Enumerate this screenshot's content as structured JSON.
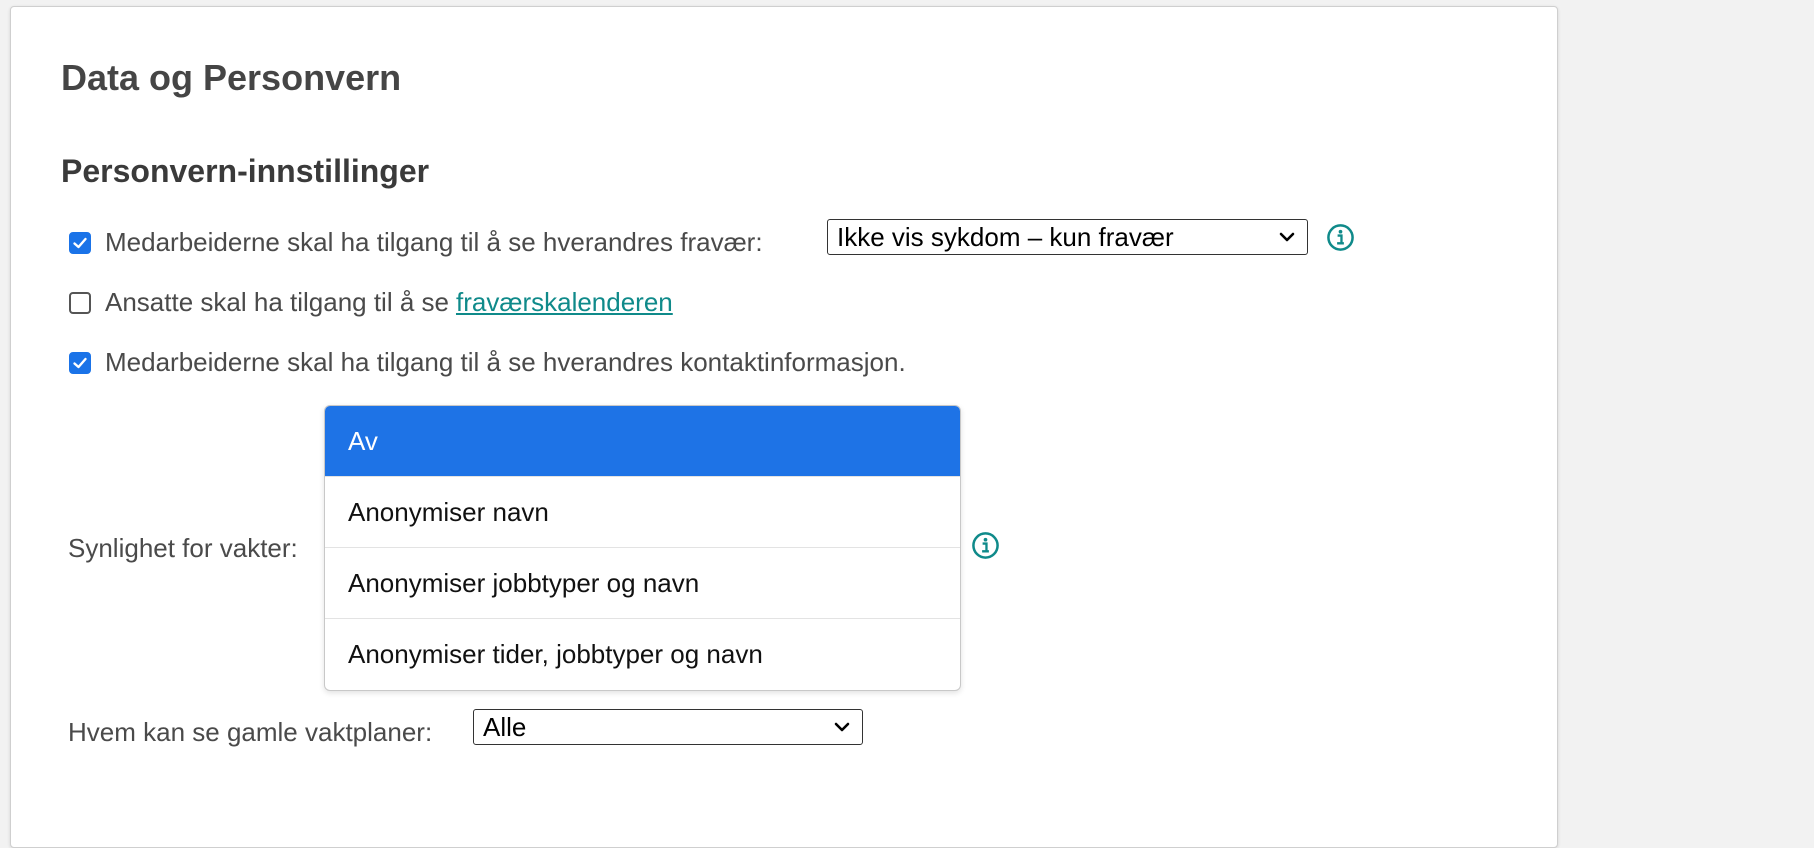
{
  "page": {
    "title": "Data og Personvern",
    "section_title": "Personvern-innstillinger"
  },
  "settings": {
    "absence": {
      "checked": true,
      "label": "Medarbeiderne skal ha tilgang til å se hverandres fravær:",
      "select_value": "Ikke vis sykdom – kun fravær"
    },
    "calendar": {
      "checked": false,
      "label": "Ansatte skal ha tilgang til å se",
      "link_text": "fraværskalenderen"
    },
    "contact": {
      "checked": true,
      "label": "Medarbeiderne skal ha tilgang til å se hverandres kontaktinformasjon."
    },
    "shift_visibility": {
      "label": "Synlighet for vakter:",
      "options": [
        "Av",
        "Anonymiser navn",
        "Anonymiser jobbtyper og navn",
        "Anonymiser tider, jobbtyper og navn"
      ],
      "selected": "Av"
    },
    "old_schedules": {
      "label": "Hvem kan se gamle vaktplaner:",
      "select_value": "Alle"
    }
  },
  "colors": {
    "accent_blue": "#1a73e8",
    "selected_option": "#1e73e6",
    "teal": "#0f8a8a",
    "text_gray": "#4a4a4a"
  },
  "icons": [
    "check-icon",
    "chevron-down-icon",
    "info-icon"
  ]
}
